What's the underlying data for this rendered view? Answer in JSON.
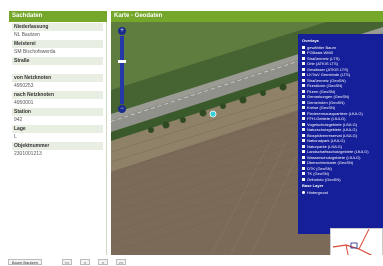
{
  "left_panel": {
    "title": "Sachdaten",
    "fields": [
      {
        "label": "Niederlassung",
        "value": "NL Bautzen"
      },
      {
        "label": "Meisterei",
        "value": "SM Bischofswerda"
      },
      {
        "label": "Straße",
        "value": ""
      },
      {
        "label": "von Netzknoten",
        "value": "4950253"
      },
      {
        "label": "nach Netzknoten",
        "value": "4950001"
      },
      {
        "label": "Station",
        "value": "942"
      },
      {
        "label": "Lage",
        "value": "L"
      },
      {
        "label": "Objektnummer",
        "value": "2301001213"
      }
    ]
  },
  "map_panel": {
    "title": "Karte - Geodaten",
    "zoom_in": "+",
    "zoom_out": "−"
  },
  "layers": {
    "overlays_title": "Overlays",
    "overlays": [
      "gewählter Baum",
      "FGBasis WMS",
      "Straßennetz (LTS)",
      "Orte (ATKIS LTS)",
      "Gewässer (ATKIS LTS)",
      "LKTwV Gemeinde (LTS)",
      "Straßennetz (GeoSN)",
      "Flurstücke (GeoSN)",
      "Fluren (GeoSN)",
      "Gemarkungen (GeoSN)",
      "Gemeinden (GeoSN)",
      "Kreise (GeoSN)",
      "Flederermausquartiere (LfULG)",
      "FFH-Gebiete (LfULG)",
      "Vogelschutzgebiete (LfULG)",
      "Naturschutzgebiete (LfULG)",
      "Biosphärenreservat (LfULG)",
      "Nationalpark (LfULG)",
      "Naturparke (LfULG)",
      "Landschaftsschutzgebiete (LfULG)",
      "Wasserschutzgebiete (LfULG)",
      "Überschirmkarte (GeoSN)",
      "DTK (GeoSN)",
      "TK (GeoSN)",
      "Orthofoto (GeoSN)"
    ],
    "base_title": "Base Layer",
    "base_layers": [
      "Hintergrund"
    ]
  },
  "bottom_bar": {
    "item_label": "Baum Bautzen",
    "buttons": [
      "<<",
      "<",
      ">",
      ">>"
    ]
  },
  "colors": {
    "header_green": "#75a82a",
    "layer_panel_blue": "#161f9a",
    "marker_cyan": "#37d0d8"
  }
}
